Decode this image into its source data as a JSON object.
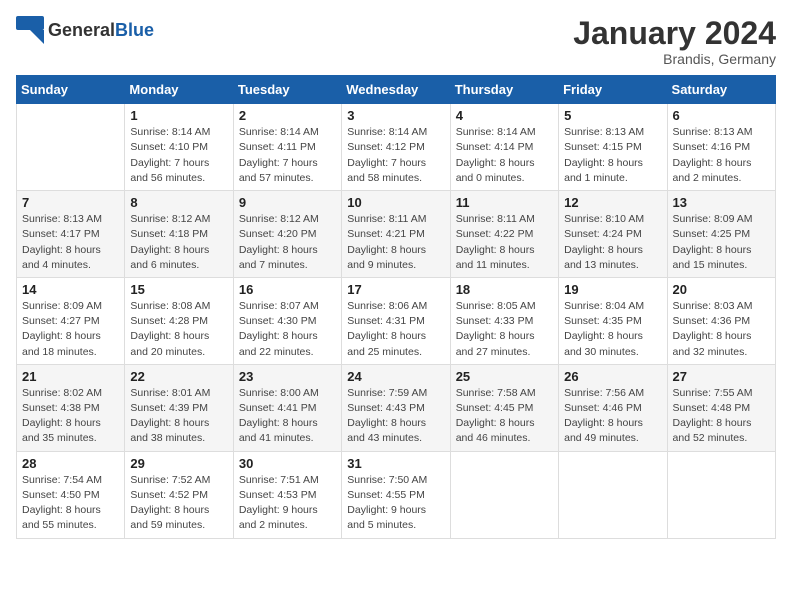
{
  "header": {
    "logo_general": "General",
    "logo_blue": "Blue",
    "month_year": "January 2024",
    "location": "Brandis, Germany"
  },
  "days_of_week": [
    "Sunday",
    "Monday",
    "Tuesday",
    "Wednesday",
    "Thursday",
    "Friday",
    "Saturday"
  ],
  "weeks": [
    [
      {
        "day": "",
        "info": ""
      },
      {
        "day": "1",
        "info": "Sunrise: 8:14 AM\nSunset: 4:10 PM\nDaylight: 7 hours\nand 56 minutes."
      },
      {
        "day": "2",
        "info": "Sunrise: 8:14 AM\nSunset: 4:11 PM\nDaylight: 7 hours\nand 57 minutes."
      },
      {
        "day": "3",
        "info": "Sunrise: 8:14 AM\nSunset: 4:12 PM\nDaylight: 7 hours\nand 58 minutes."
      },
      {
        "day": "4",
        "info": "Sunrise: 8:14 AM\nSunset: 4:14 PM\nDaylight: 8 hours\nand 0 minutes."
      },
      {
        "day": "5",
        "info": "Sunrise: 8:13 AM\nSunset: 4:15 PM\nDaylight: 8 hours\nand 1 minute."
      },
      {
        "day": "6",
        "info": "Sunrise: 8:13 AM\nSunset: 4:16 PM\nDaylight: 8 hours\nand 2 minutes."
      }
    ],
    [
      {
        "day": "7",
        "info": "Sunrise: 8:13 AM\nSunset: 4:17 PM\nDaylight: 8 hours\nand 4 minutes."
      },
      {
        "day": "8",
        "info": "Sunrise: 8:12 AM\nSunset: 4:18 PM\nDaylight: 8 hours\nand 6 minutes."
      },
      {
        "day": "9",
        "info": "Sunrise: 8:12 AM\nSunset: 4:20 PM\nDaylight: 8 hours\nand 7 minutes."
      },
      {
        "day": "10",
        "info": "Sunrise: 8:11 AM\nSunset: 4:21 PM\nDaylight: 8 hours\nand 9 minutes."
      },
      {
        "day": "11",
        "info": "Sunrise: 8:11 AM\nSunset: 4:22 PM\nDaylight: 8 hours\nand 11 minutes."
      },
      {
        "day": "12",
        "info": "Sunrise: 8:10 AM\nSunset: 4:24 PM\nDaylight: 8 hours\nand 13 minutes."
      },
      {
        "day": "13",
        "info": "Sunrise: 8:09 AM\nSunset: 4:25 PM\nDaylight: 8 hours\nand 15 minutes."
      }
    ],
    [
      {
        "day": "14",
        "info": "Sunrise: 8:09 AM\nSunset: 4:27 PM\nDaylight: 8 hours\nand 18 minutes."
      },
      {
        "day": "15",
        "info": "Sunrise: 8:08 AM\nSunset: 4:28 PM\nDaylight: 8 hours\nand 20 minutes."
      },
      {
        "day": "16",
        "info": "Sunrise: 8:07 AM\nSunset: 4:30 PM\nDaylight: 8 hours\nand 22 minutes."
      },
      {
        "day": "17",
        "info": "Sunrise: 8:06 AM\nSunset: 4:31 PM\nDaylight: 8 hours\nand 25 minutes."
      },
      {
        "day": "18",
        "info": "Sunrise: 8:05 AM\nSunset: 4:33 PM\nDaylight: 8 hours\nand 27 minutes."
      },
      {
        "day": "19",
        "info": "Sunrise: 8:04 AM\nSunset: 4:35 PM\nDaylight: 8 hours\nand 30 minutes."
      },
      {
        "day": "20",
        "info": "Sunrise: 8:03 AM\nSunset: 4:36 PM\nDaylight: 8 hours\nand 32 minutes."
      }
    ],
    [
      {
        "day": "21",
        "info": "Sunrise: 8:02 AM\nSunset: 4:38 PM\nDaylight: 8 hours\nand 35 minutes."
      },
      {
        "day": "22",
        "info": "Sunrise: 8:01 AM\nSunset: 4:39 PM\nDaylight: 8 hours\nand 38 minutes."
      },
      {
        "day": "23",
        "info": "Sunrise: 8:00 AM\nSunset: 4:41 PM\nDaylight: 8 hours\nand 41 minutes."
      },
      {
        "day": "24",
        "info": "Sunrise: 7:59 AM\nSunset: 4:43 PM\nDaylight: 8 hours\nand 43 minutes."
      },
      {
        "day": "25",
        "info": "Sunrise: 7:58 AM\nSunset: 4:45 PM\nDaylight: 8 hours\nand 46 minutes."
      },
      {
        "day": "26",
        "info": "Sunrise: 7:56 AM\nSunset: 4:46 PM\nDaylight: 8 hours\nand 49 minutes."
      },
      {
        "day": "27",
        "info": "Sunrise: 7:55 AM\nSunset: 4:48 PM\nDaylight: 8 hours\nand 52 minutes."
      }
    ],
    [
      {
        "day": "28",
        "info": "Sunrise: 7:54 AM\nSunset: 4:50 PM\nDaylight: 8 hours\nand 55 minutes."
      },
      {
        "day": "29",
        "info": "Sunrise: 7:52 AM\nSunset: 4:52 PM\nDaylight: 8 hours\nand 59 minutes."
      },
      {
        "day": "30",
        "info": "Sunrise: 7:51 AM\nSunset: 4:53 PM\nDaylight: 9 hours\nand 2 minutes."
      },
      {
        "day": "31",
        "info": "Sunrise: 7:50 AM\nSunset: 4:55 PM\nDaylight: 9 hours\nand 5 minutes."
      },
      {
        "day": "",
        "info": ""
      },
      {
        "day": "",
        "info": ""
      },
      {
        "day": "",
        "info": ""
      }
    ]
  ]
}
